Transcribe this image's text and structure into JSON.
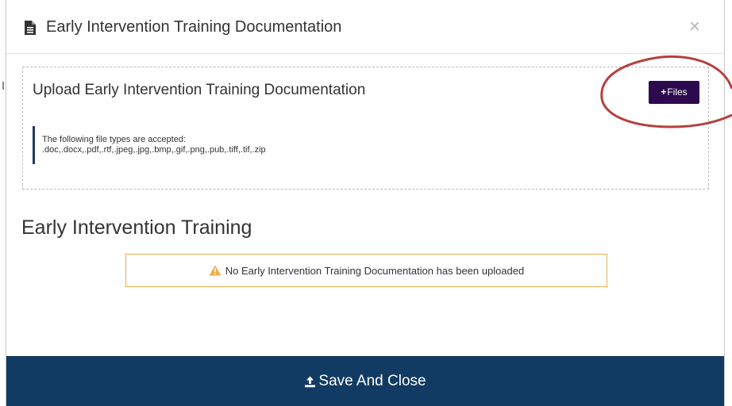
{
  "modal": {
    "title": "Early Intervention Training Documentation",
    "header_icon": "document-icon",
    "close_label": "×"
  },
  "upload": {
    "title": "Upload Early Intervention Training Documentation",
    "files_button_plus": "+",
    "files_button_label": "Files",
    "accepted_heading": "The following file types are accepted:",
    "accepted_types": ".doc,.docx,.pdf,.rtf,.jpeg,.jpg,.bmp,.gif,.png,.pub,.tiff,.tif,.zip"
  },
  "section": {
    "title": "Early Intervention Training",
    "warning_icon": "warning-triangle-icon",
    "warning_text": "No Early Intervention Training Documentation has been uploaded"
  },
  "footer": {
    "save_icon": "upload-icon",
    "save_label": "Save And Close"
  },
  "colors": {
    "primary_footer": "#113b62",
    "files_button": "#2d0a4e",
    "warning_border": "#f0ad4e",
    "warning_icon": "#f0ad4e",
    "highlight_ellipse": "#b5403f",
    "note_bar": "#1f3864"
  }
}
